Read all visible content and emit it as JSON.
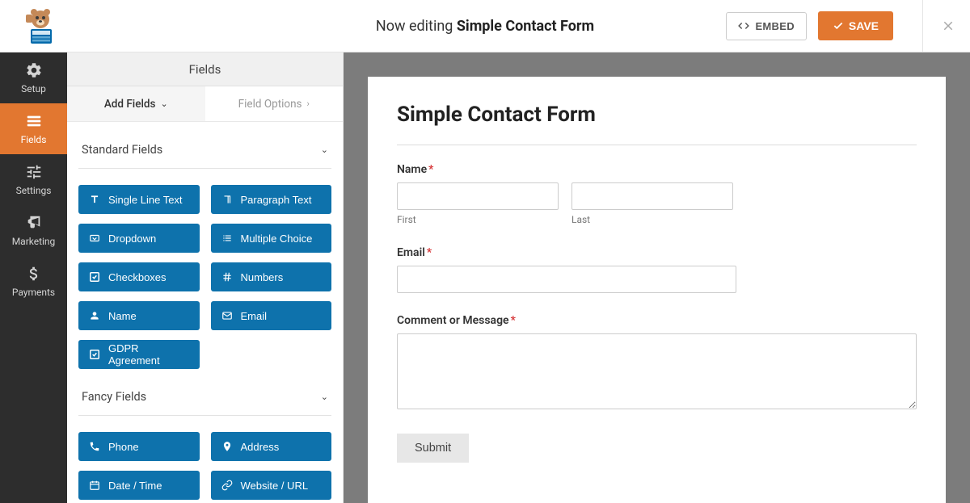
{
  "header": {
    "now_editing_prefix": "Now editing ",
    "form_name": "Simple Contact Form",
    "embed_label": "EMBED",
    "save_label": "SAVE"
  },
  "nav": {
    "items": [
      {
        "label": "Setup",
        "icon": "gear"
      },
      {
        "label": "Fields",
        "icon": "fields",
        "active": true
      },
      {
        "label": "Settings",
        "icon": "sliders"
      },
      {
        "label": "Marketing",
        "icon": "bullhorn"
      },
      {
        "label": "Payments",
        "icon": "dollar"
      }
    ]
  },
  "panel": {
    "header": "Fields",
    "tabs": {
      "add": "Add Fields",
      "options": "Field Options"
    },
    "sections": [
      {
        "title": "Standard Fields",
        "fields": [
          {
            "label": "Single Line Text",
            "icon": "text"
          },
          {
            "label": "Paragraph Text",
            "icon": "paragraph"
          },
          {
            "label": "Dropdown",
            "icon": "dropdown"
          },
          {
            "label": "Multiple Choice",
            "icon": "list"
          },
          {
            "label": "Checkboxes",
            "icon": "check"
          },
          {
            "label": "Numbers",
            "icon": "hash"
          },
          {
            "label": "Name",
            "icon": "user"
          },
          {
            "label": "Email",
            "icon": "envelope"
          },
          {
            "label": "GDPR Agreement",
            "icon": "check"
          }
        ]
      },
      {
        "title": "Fancy Fields",
        "fields": [
          {
            "label": "Phone",
            "icon": "phone"
          },
          {
            "label": "Address",
            "icon": "pin"
          },
          {
            "label": "Date / Time",
            "icon": "calendar"
          },
          {
            "label": "Website / URL",
            "icon": "link"
          }
        ]
      }
    ]
  },
  "form": {
    "title": "Simple Contact Form",
    "name_label": "Name",
    "first_sub": "First",
    "last_sub": "Last",
    "email_label": "Email",
    "comment_label": "Comment or Message",
    "submit_label": "Submit"
  }
}
